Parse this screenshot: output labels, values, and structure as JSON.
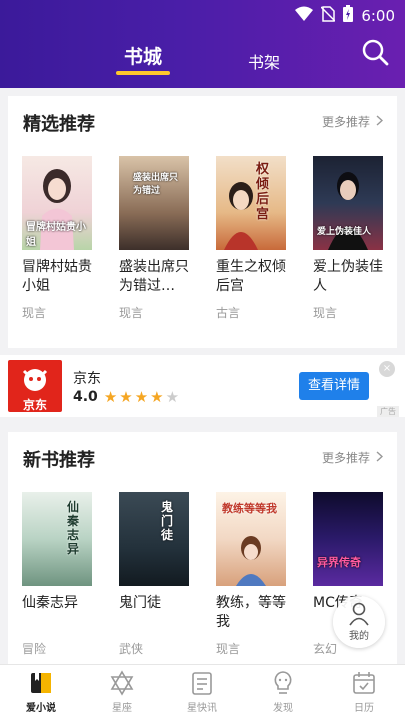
{
  "status_bar": {
    "time": "6:00"
  },
  "header": {
    "tabs": [
      {
        "label": "书城",
        "active": true
      },
      {
        "label": "书架",
        "active": false
      }
    ],
    "accent_color": "#ffc82c"
  },
  "featured": {
    "title": "精选推荐",
    "more": "更多推荐",
    "books": [
      {
        "title": "冒牌村姑贵小姐",
        "tag": "现言",
        "cover_text": "冒牌村姑贵小姐"
      },
      {
        "title": "盛装出席只为错过…",
        "tag": "现言",
        "cover_text": "盛装出席只为错过"
      },
      {
        "title": "重生之权倾后宫",
        "tag": "古言",
        "cover_text": "权倾后宫"
      },
      {
        "title": "爱上伪装佳人",
        "tag": "现言",
        "cover_text": "爱上伪装佳人"
      }
    ]
  },
  "ad": {
    "name": "京东",
    "rating": "4.0",
    "stars": 4,
    "button": "查看详情",
    "logo_text": "京东",
    "mark": "广告",
    "close": "×"
  },
  "new_books": {
    "title": "新书推荐",
    "more": "更多推荐",
    "books": [
      {
        "title": "仙秦志异",
        "tag": "冒险",
        "cover_text": "仙秦志异"
      },
      {
        "title": "鬼门徒",
        "tag": "武侠",
        "cover_text": "鬼门徒"
      },
      {
        "title": "教练，等等我",
        "tag": "现言",
        "cover_text": "教练等等我"
      },
      {
        "title": "MC传奇",
        "tag": "玄幻",
        "cover_text": "异界传奇"
      }
    ]
  },
  "floating": {
    "label": "我的"
  },
  "bottom_nav": [
    {
      "label": "爱小说",
      "icon": "book-icon",
      "active": true
    },
    {
      "label": "星座",
      "icon": "star-of-david-icon",
      "active": false
    },
    {
      "label": "星快讯",
      "icon": "news-icon",
      "active": false
    },
    {
      "label": "发现",
      "icon": "bulb-icon",
      "active": false
    },
    {
      "label": "日历",
      "icon": "calendar-icon",
      "active": false
    }
  ]
}
